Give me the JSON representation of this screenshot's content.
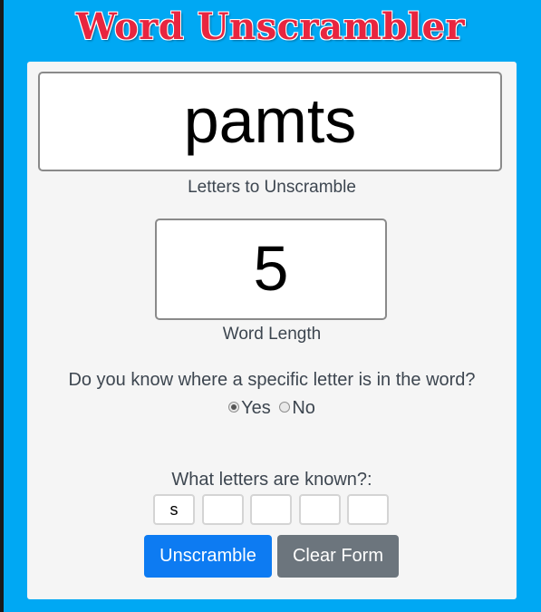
{
  "app": {
    "title": "Word Unscrambler"
  },
  "letters_field": {
    "value": "pamts",
    "label": "Letters to Unscramble"
  },
  "length_field": {
    "value": "5",
    "label": "Word Length"
  },
  "position_question": {
    "text": "Do you know where a specific letter is in the word?",
    "options": [
      {
        "label": "Yes",
        "selected": true
      },
      {
        "label": "No",
        "selected": false
      }
    ]
  },
  "known_letters": {
    "label": "What letters are known?:",
    "slots": [
      "s",
      "",
      "",
      "",
      ""
    ]
  },
  "buttons": {
    "unscramble": "Unscramble",
    "clear": "Clear Form"
  },
  "colors": {
    "background": "#00a8f3",
    "title": "#e8253f",
    "primary_button": "#0d7bf2",
    "secondary_button": "#6c757d"
  }
}
